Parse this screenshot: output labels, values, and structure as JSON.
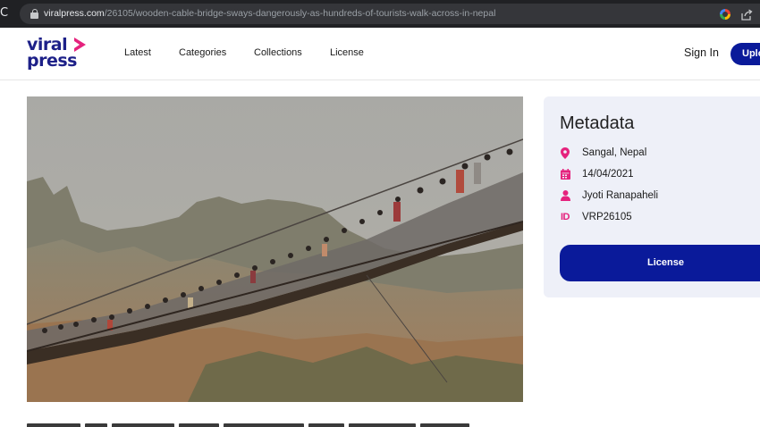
{
  "browser": {
    "url_host": "viralpress.com",
    "url_path": "/26105/wooden-cable-bridge-sways-dangerously-as-hundreds-of-tourists-walk-across-in-nepal"
  },
  "header": {
    "logo_line1": "viral",
    "logo_line2": "press",
    "nav": [
      "Latest",
      "Categories",
      "Collections",
      "License"
    ],
    "sign_in": "Sign In",
    "upload_label": "Upload"
  },
  "metadata": {
    "title": "Metadata",
    "location": "Sangal, Nepal",
    "date": "14/04/2021",
    "author": "Jyoti Ranapaheli",
    "id_icon_label": "ID",
    "id": "VRP26105",
    "license_label": "License"
  },
  "colors": {
    "brand_navy": "#0a1a9a",
    "brand_pink": "#e5227d",
    "card_bg": "#eef0f8"
  }
}
